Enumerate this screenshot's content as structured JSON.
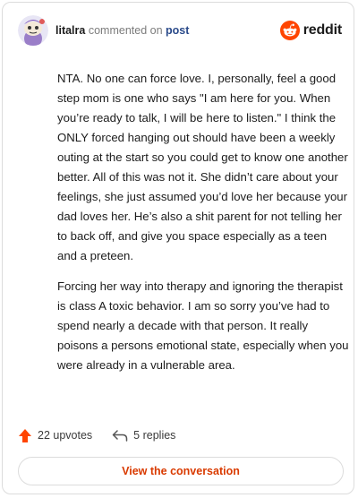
{
  "comment": {
    "username": "litalra",
    "commented_on": "commented on",
    "post_link": "post",
    "paragraphs": [
      "NTA. No one can force love. I, personally, feel a good step mom is one who says \"I am here for you. When you’re ready to talk, I will be here to listen.\" I think the ONLY forced hanging out should have been a weekly outing at the start so you could get to know one another better. All of this was not it. She didn’t care about your feelings, she just assumed you’d love her because your dad loves her. He’s also a shit parent for not telling her to back off, and give you space especially as a teen and a preteen.",
      "Forcing her way into therapy and ignoring the therapist is class A toxic behavior. I am so sorry you’ve had to spend nearly a decade with that person. It really poisons a persons emotional state, especially when you were already in a vulnerable area."
    ]
  },
  "brand": {
    "name": "reddit",
    "icon": "reddit-logo-icon",
    "color": "#ff4500"
  },
  "actions": {
    "upvotes": "22 upvotes",
    "replies": "5 replies",
    "upvote_icon": "upvote-arrow-icon",
    "reply_icon": "reply-arrow-icon"
  },
  "cta": {
    "label": "View the conversation",
    "color": "#d93a00"
  }
}
